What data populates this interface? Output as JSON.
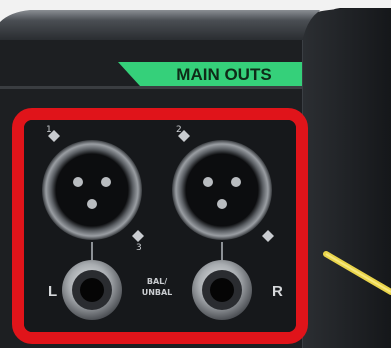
{
  "device": {
    "section_label": "MAIN OUTS",
    "left_channel_label": "L",
    "right_channel_label": "R",
    "jack_note_line1": "BAL/",
    "jack_note_line2": "UNBAL",
    "xlr_pin_marks": [
      "1",
      "2",
      "3"
    ]
  },
  "highlight": {
    "color": "#e0141a"
  },
  "colors": {
    "panel": "#1d1f22",
    "label_badge": "#35d07a",
    "cable": "#e9d44a"
  }
}
